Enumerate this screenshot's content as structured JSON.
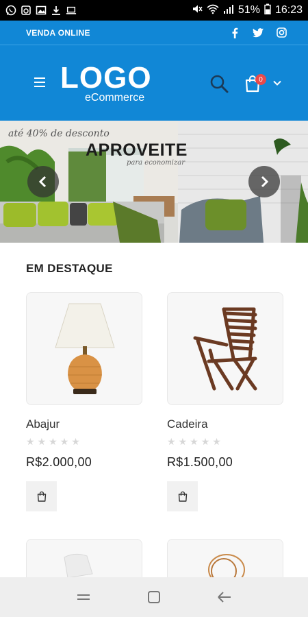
{
  "status_bar": {
    "battery": "51%",
    "time": "16:23",
    "left_icons": [
      "whatsapp-icon",
      "alarm-icon",
      "image-icon",
      "download-icon",
      "laptop-icon"
    ],
    "right_icons": [
      "mute-icon",
      "wifi-icon",
      "signal-icon",
      "battery-icon"
    ]
  },
  "top_strip": {
    "tagline": "VENDA ONLINE",
    "socials": [
      "facebook-icon",
      "twitter-icon",
      "instagram-icon"
    ]
  },
  "header": {
    "logo_main": "LOGO",
    "logo_sub": "eCommerce",
    "cart_count": "0",
    "brand_color": "#1187d6"
  },
  "banner": {
    "promo": "até 40% de desconto",
    "title": "APROVEITE",
    "subtitle": "para economizar"
  },
  "featured": {
    "title": "EM DESTAQUE",
    "products": [
      {
        "name": "Abajur",
        "rating": 0,
        "price": "R$2.000,00"
      },
      {
        "name": "Cadeira",
        "rating": 0,
        "price": "R$1.500,00"
      }
    ]
  },
  "android_nav": [
    "recents-icon",
    "home-icon",
    "back-icon"
  ]
}
